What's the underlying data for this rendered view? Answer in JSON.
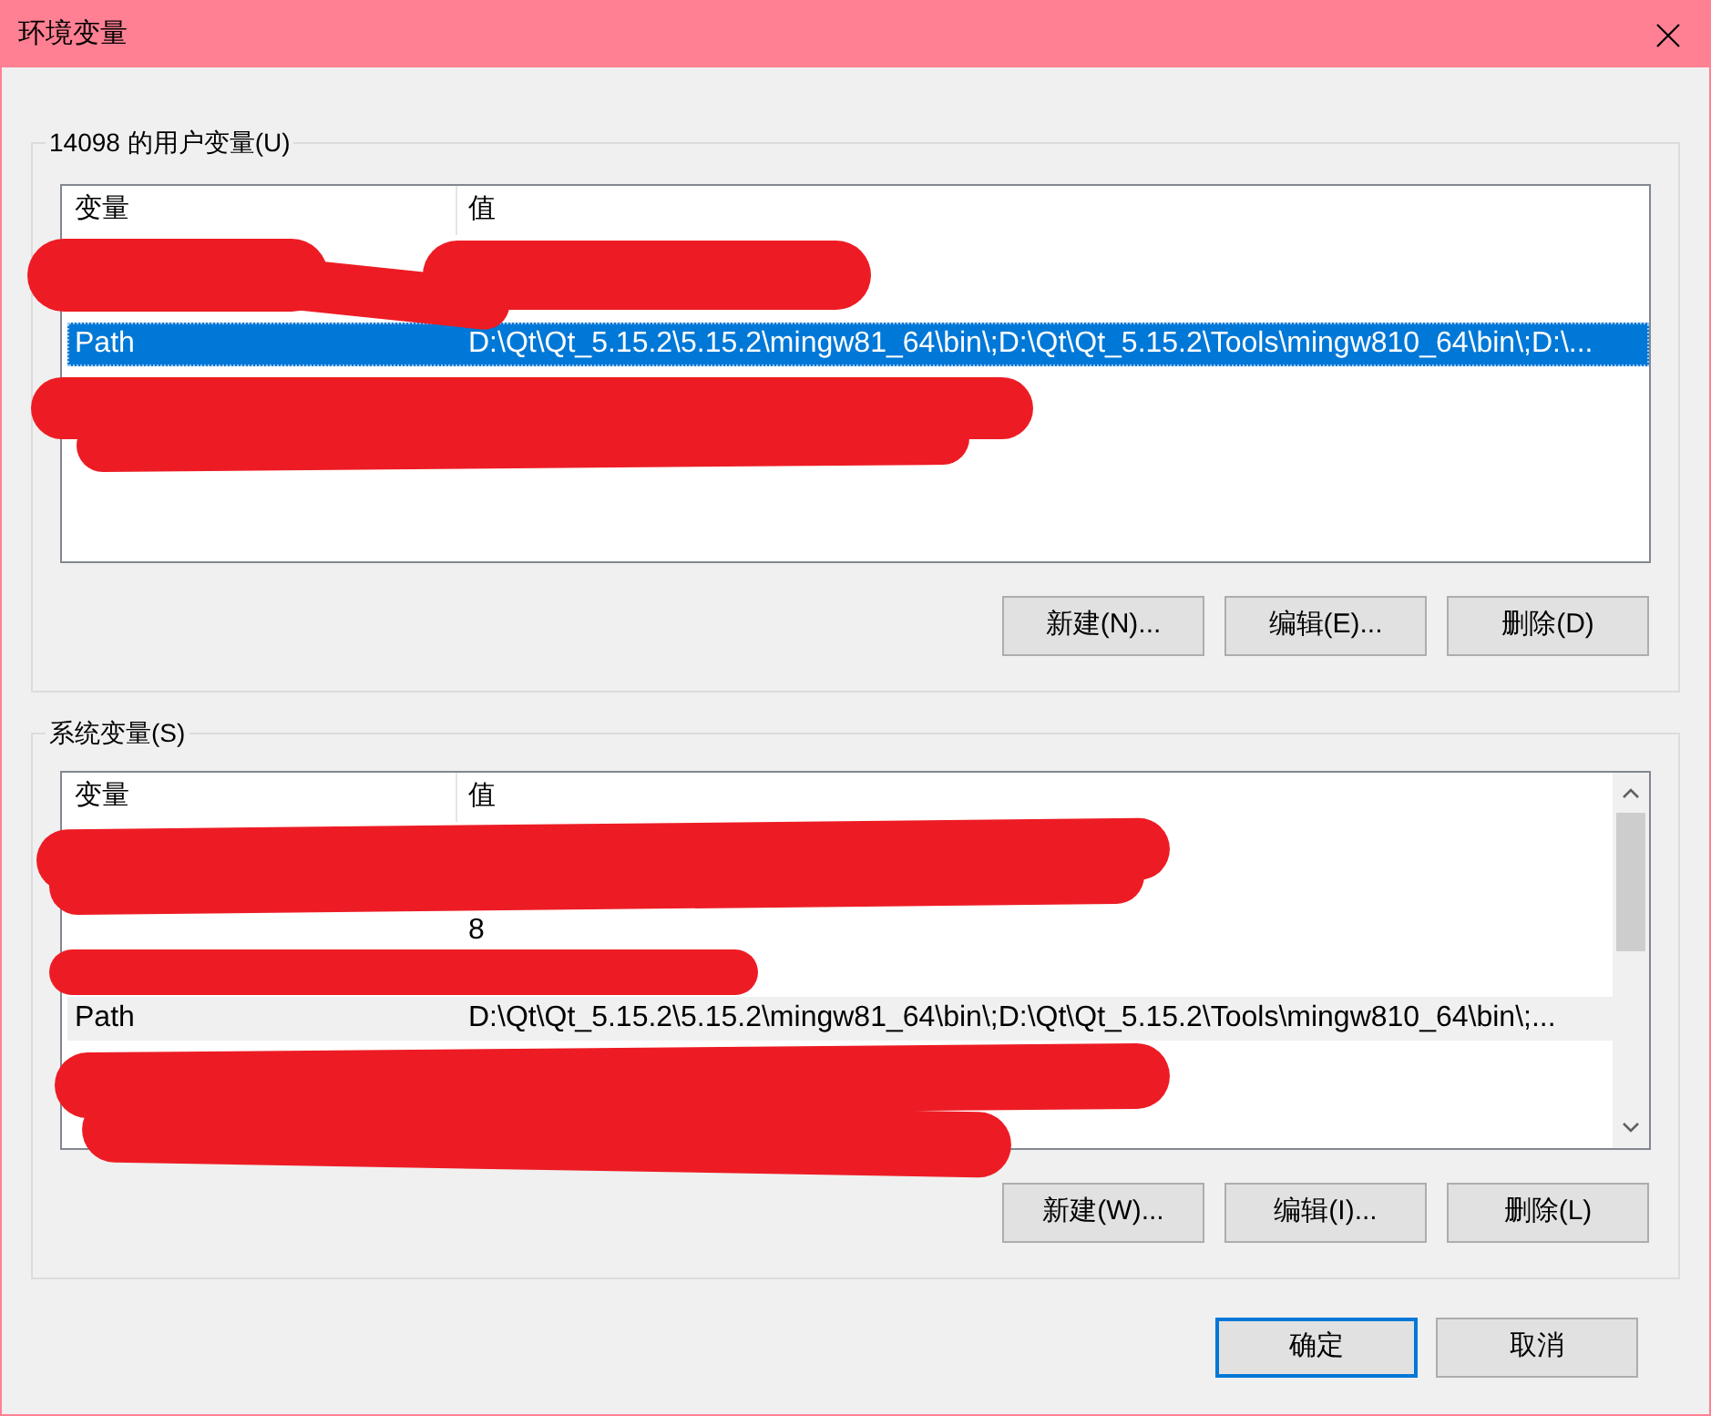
{
  "window": {
    "title": "环境变量"
  },
  "user_variables": {
    "title": "14098 的用户变量(U)",
    "focused": true,
    "scrollable": false,
    "columns": [
      "变量",
      "值"
    ],
    "rows": [
      {
        "selected": false
      },
      {
        "selected": false
      },
      {
        "variable": "Path",
        "value": "D:\\Qt\\Qt_5.15.2\\5.15.2\\mingw81_64\\bin\\;D:\\Qt\\Qt_5.15.2\\Tools\\mingw810_64\\bin\\;D:\\...",
        "selected": true
      },
      {
        "selected": false
      },
      {
        "selected": false
      }
    ],
    "buttons": [
      "新建(N)...",
      "编辑(E)...",
      "删除(D)"
    ]
  },
  "system_variables": {
    "title": "系统变量(S)",
    "focused": false,
    "scrollable": true,
    "columns": [
      "变量",
      "值"
    ],
    "rows": [
      {
        "selected": false
      },
      {
        "selected": false
      },
      {
        "value": "8",
        "selected": false
      },
      {
        "selected": false
      },
      {
        "variable": "Path",
        "value": "D:\\Qt\\Qt_5.15.2\\5.15.2\\mingw81_64\\bin\\;D:\\Qt\\Qt_5.15.2\\Tools\\mingw810_64\\bin\\;...",
        "selected": true
      },
      {
        "selected": false
      },
      {
        "selected": false
      }
    ],
    "buttons": [
      "新建(W)...",
      "编辑(I)...",
      "删除(L)"
    ]
  },
  "buttons": [
    {
      "label": "确定",
      "default": true
    },
    {
      "label": "取消",
      "default": false
    }
  ]
}
